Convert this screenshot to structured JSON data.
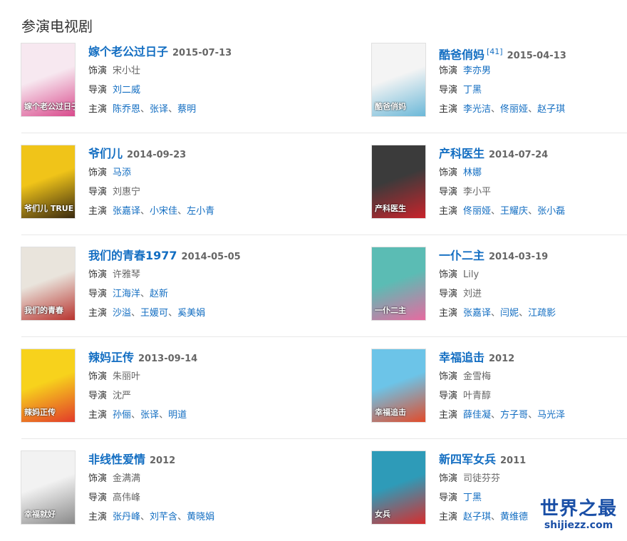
{
  "page_title": "参演电视剧",
  "labels": {
    "role": "饰演",
    "director": "导演",
    "cast": "主演"
  },
  "separator": "、",
  "watermark": {
    "text": "世界之最",
    "url": "shijiezz.com"
  },
  "dramas": [
    {
      "title": "嫁个老公过日子",
      "date": "2015-07-13",
      "sup": "",
      "role": "宋小壮",
      "role_link": false,
      "directors": [
        "刘二威"
      ],
      "cast": [
        "陈乔恩",
        "张译",
        "蔡明"
      ],
      "poster_text": "嫁个老公过日子",
      "poster_colors": [
        "#f7e8f0",
        "#d94a8c"
      ]
    },
    {
      "title": "酷爸俏妈",
      "date": "2015-04-13",
      "sup": "[41]",
      "role": "李亦男",
      "role_link": true,
      "directors": [
        "丁黑"
      ],
      "cast": [
        "李光洁",
        "佟丽娅",
        "赵子琪"
      ],
      "poster_text": "酷爸俏妈",
      "poster_colors": [
        "#f4f4f4",
        "#6bb8d8"
      ]
    },
    {
      "title": "爷们儿",
      "date": "2014-09-23",
      "sup": "",
      "role": "马添",
      "role_link": true,
      "directors": [
        "刘惠宁"
      ],
      "cast": [
        "张嘉译",
        "小宋佳",
        "左小青"
      ],
      "poster_text": "爷们儿 TRUE MAN",
      "poster_colors": [
        "#f0c419",
        "#3a2a10"
      ]
    },
    {
      "title": "产科医生",
      "date": "2014-07-24",
      "sup": "",
      "role": "林娜",
      "role_link": true,
      "directors": [
        "李小平"
      ],
      "cast": [
        "佟丽娅",
        "王耀庆",
        "张小磊"
      ],
      "poster_text": "产科医生",
      "poster_colors": [
        "#3b3b3b",
        "#c9232b"
      ]
    },
    {
      "title": "我们的青春1977",
      "date": "2014-05-05",
      "sup": "",
      "role": "许雅琴",
      "role_link": false,
      "directors": [
        "江海洋",
        "赵新"
      ],
      "cast": [
        "沙溢",
        "王媛可",
        "奚美娟"
      ],
      "poster_text": "我们的青春",
      "poster_colors": [
        "#e9e4dc",
        "#b8332e"
      ]
    },
    {
      "title": "一仆二主",
      "date": "2014-03-19",
      "sup": "",
      "role": "Lily",
      "role_link": false,
      "directors": [
        "刘进"
      ],
      "cast": [
        "张嘉译",
        "闫妮",
        "江疏影"
      ],
      "poster_text": "一仆二主",
      "poster_colors": [
        "#5bbcb4",
        "#e76aa0"
      ]
    },
    {
      "title": "辣妈正传",
      "date": "2013-09-14",
      "sup": "",
      "role": "朱丽叶",
      "role_link": false,
      "directors": [
        "沈严"
      ],
      "cast": [
        "孙俪",
        "张译",
        "明道"
      ],
      "poster_text": "辣妈正传",
      "poster_colors": [
        "#f7d21c",
        "#e23b2a"
      ]
    },
    {
      "title": "幸福追击",
      "date": "2012",
      "sup": "",
      "role": "金雪梅",
      "role_link": false,
      "directors": [
        "叶青醇"
      ],
      "cast": [
        "薛佳凝",
        "方子哥",
        "马光泽"
      ],
      "poster_text": "幸福追击",
      "poster_colors": [
        "#6cc4e8",
        "#e24b2a"
      ]
    },
    {
      "title": "非线性爱情",
      "date": "2012",
      "sup": "",
      "role": "金满满",
      "role_link": false,
      "directors": [
        "高伟峰"
      ],
      "cast": [
        "张丹峰",
        "刘芊含",
        "黄晓娟"
      ],
      "poster_text": "幸福就好",
      "poster_colors": [
        "#f2f2f2",
        "#8a8a8a"
      ]
    },
    {
      "title": "新四军女兵",
      "date": "2011",
      "sup": "",
      "role": "司徒芬芬",
      "role_link": false,
      "directors": [
        "丁黑"
      ],
      "cast": [
        "赵子琪",
        "黄维德"
      ],
      "poster_text": "女兵",
      "poster_colors": [
        "#2e9bb8",
        "#d72d2d"
      ]
    }
  ]
}
